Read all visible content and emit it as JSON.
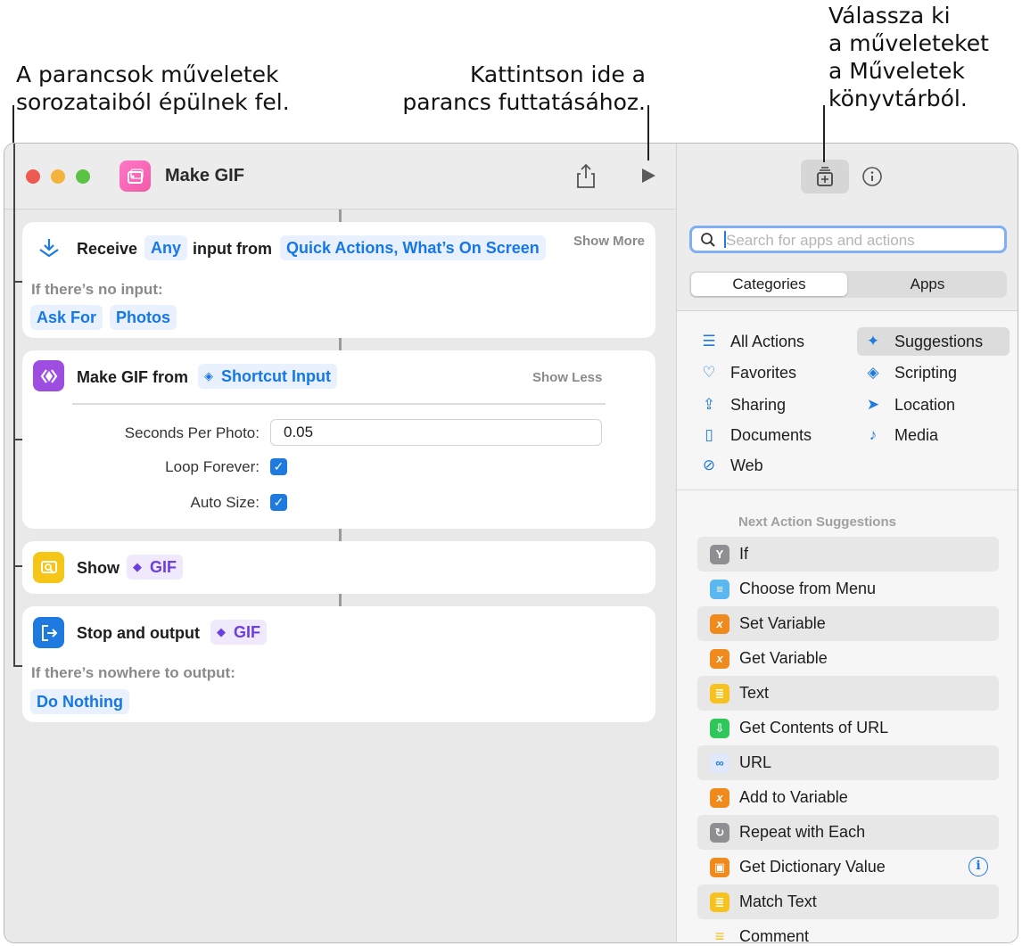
{
  "callouts": {
    "left": "A parancsok műveletek sorozataiból épülnek fel.",
    "left_line1": "A parancsok műveletek",
    "left_line2": "sorozataiból épülnek fel.",
    "middle_line1": "Kattintson ide a",
    "middle_line2": "parancs futtatásához.",
    "right_line1": "Válassza ki",
    "right_line2": "a műveleteket",
    "right_line3": "a Műveletek",
    "right_line4": "könyvtárból."
  },
  "window": {
    "title": "Make GIF",
    "icons": {
      "app": "photo-gallery-icon",
      "share": "share-icon",
      "run": "play-icon",
      "library": "action-library-icon",
      "info": "info-icon"
    }
  },
  "actions": {
    "receive": {
      "label": "Receive",
      "type_token": "Any",
      "middle": "input from",
      "source_token": "Quick Actions, What’s On Screen",
      "toggle": "Show More",
      "no_input_label": "If there’s no input:",
      "ask_token": "Ask For",
      "photos_token": "Photos"
    },
    "make_gif": {
      "label": "Make GIF from",
      "input_token": "Shortcut Input",
      "toggle": "Show Less",
      "seconds_label": "Seconds Per Photo:",
      "seconds_value": "0.05",
      "loop_label": "Loop Forever:",
      "loop_checked": true,
      "autosize_label": "Auto Size:",
      "autosize_checked": true
    },
    "show": {
      "label": "Show",
      "token": "GIF"
    },
    "stop": {
      "label": "Stop and output",
      "token": "GIF",
      "nowhere_label": "If there’s nowhere to output:",
      "nothing_token": "Do Nothing"
    }
  },
  "library": {
    "search_placeholder": "Search for apps and actions",
    "tab_categories": "Categories",
    "tab_apps": "Apps",
    "categories": [
      {
        "label": "All Actions",
        "icon": "list-icon"
      },
      {
        "label": "Suggestions",
        "icon": "sparkle-icon"
      },
      {
        "label": "Favorites",
        "icon": "heart-icon"
      },
      {
        "label": "Scripting",
        "icon": "scripting-icon"
      },
      {
        "label": "Sharing",
        "icon": "share-icon"
      },
      {
        "label": "Location",
        "icon": "location-arrow-icon"
      },
      {
        "label": "Documents",
        "icon": "document-icon"
      },
      {
        "label": "Media",
        "icon": "music-note-icon"
      },
      {
        "label": "Web",
        "icon": "compass-icon"
      }
    ],
    "suggestions_heading": "Next Action Suggestions",
    "suggestions": [
      {
        "label": "If",
        "color": "#8e8e93"
      },
      {
        "label": "Choose from Menu",
        "color": "#5ab7f0"
      },
      {
        "label": "Set Variable",
        "color": "#f08a1c"
      },
      {
        "label": "Get Variable",
        "color": "#f08a1c"
      },
      {
        "label": "Text",
        "color": "#f7c21d"
      },
      {
        "label": "Get Contents of URL",
        "color": "#2fc65a"
      },
      {
        "label": "URL",
        "color": "#dfe9fb"
      },
      {
        "label": "Add to Variable",
        "color": "#f08a1c"
      },
      {
        "label": "Repeat with Each",
        "color": "#8e8e93"
      },
      {
        "label": "Get Dictionary Value",
        "color": "#f08a1c"
      },
      {
        "label": "Match Text",
        "color": "#f7c21d"
      },
      {
        "label": "Comment",
        "color": "#f7c21d"
      }
    ]
  }
}
